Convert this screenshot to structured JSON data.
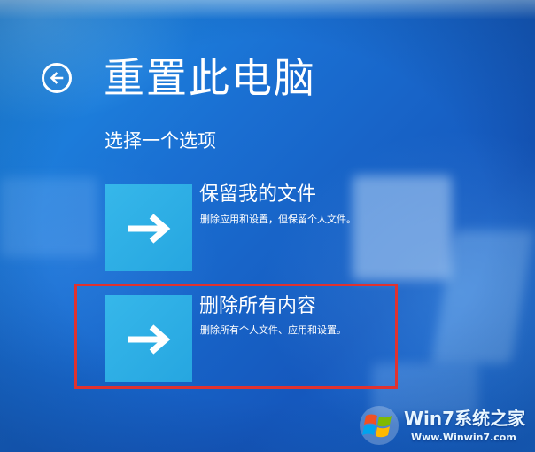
{
  "header": {
    "title": "重置此电脑",
    "subtitle": "选择一个选项"
  },
  "options": [
    {
      "title": "保留我的文件",
      "description": "删除应用和设置，但保留个人文件。",
      "icon": "right-arrow-icon"
    },
    {
      "title": "删除所有内容",
      "description": "删除所有个人文件、应用和设置。",
      "icon": "right-arrow-icon",
      "highlighted": true
    }
  ],
  "watermark": {
    "brand": "Win7系统之家",
    "url": "Www.Winwin7.com"
  },
  "colors": {
    "background": "#1a6fd2",
    "tile": "#2aa9e2",
    "highlight": "#e0322f",
    "text": "#ffffff"
  }
}
